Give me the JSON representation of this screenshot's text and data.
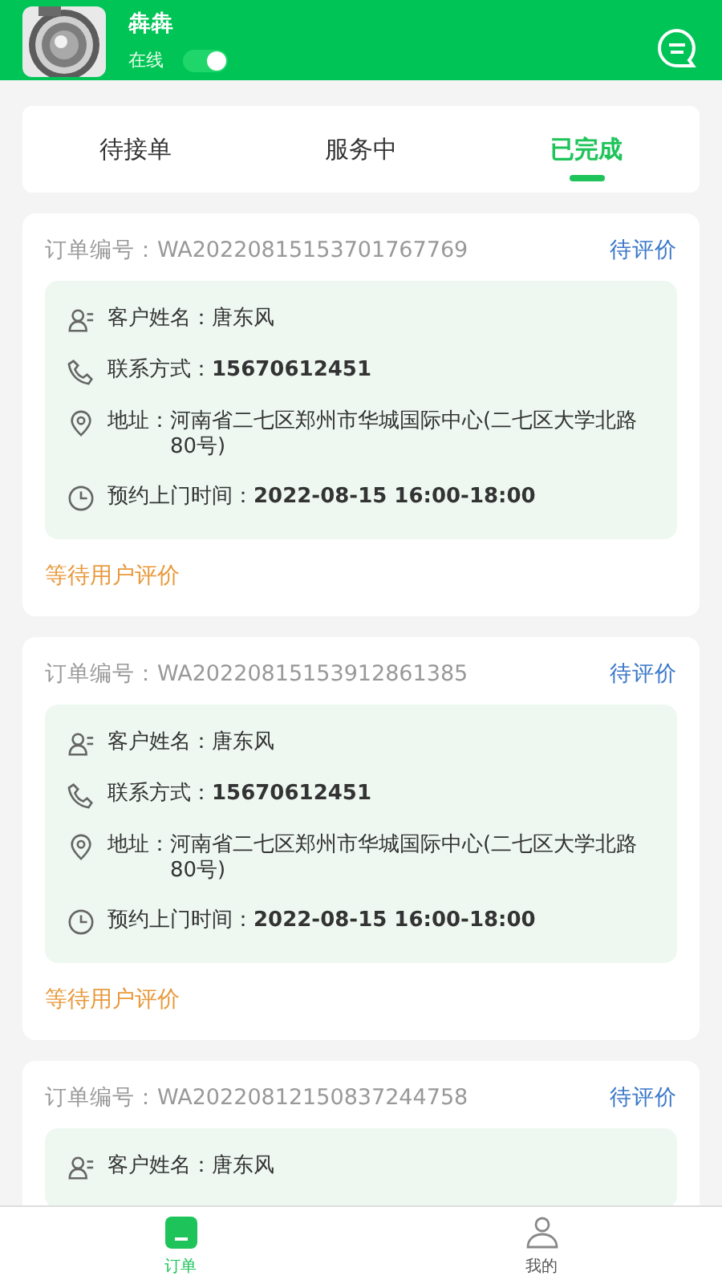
{
  "header": {
    "name": "犇犇",
    "status_label": "在线",
    "online": true
  },
  "tabs": [
    {
      "label": "待接单",
      "selected": false
    },
    {
      "label": "服务中",
      "selected": false
    },
    {
      "label": "已完成",
      "selected": true
    }
  ],
  "orders": [
    {
      "order_no": "订单编号：WA20220815153701767769",
      "status": "待评价",
      "fields": [
        {
          "kind": "person",
          "label": "客户姓名：",
          "value": "唐东风",
          "bold": false
        },
        {
          "kind": "phone",
          "label": "联系方式：",
          "value": "15670612451",
          "bold": true
        },
        {
          "kind": "location",
          "label": "地址：",
          "value": "河南省二七区郑州市华城国际中心(二七区大学北路80号)",
          "bold": false
        },
        {
          "kind": "clock",
          "label": "预约上门时间：",
          "value": "2022-08-15 16:00-18:00",
          "bold": true
        }
      ],
      "footer": "等待用户评价"
    },
    {
      "order_no": "订单编号：WA20220815153912861385",
      "status": "待评价",
      "fields": [
        {
          "kind": "person",
          "label": "客户姓名：",
          "value": "唐东风",
          "bold": false
        },
        {
          "kind": "phone",
          "label": "联系方式：",
          "value": "15670612451",
          "bold": true
        },
        {
          "kind": "location",
          "label": "地址：",
          "value": "河南省二七区郑州市华城国际中心(二七区大学北路80号)",
          "bold": false
        },
        {
          "kind": "clock",
          "label": "预约上门时间：",
          "value": "2022-08-15 16:00-18:00",
          "bold": true
        }
      ],
      "footer": "等待用户评价"
    },
    {
      "order_no": "订单编号：WA20220812150837244758",
      "status": "待评价",
      "fields": [
        {
          "kind": "person",
          "label": "客户姓名：",
          "value": "唐东风",
          "bold": false
        }
      ]
    }
  ],
  "bottom_nav": [
    {
      "kind": "orders",
      "label": "订单",
      "selected": true
    },
    {
      "kind": "profile",
      "label": "我的",
      "selected": false
    }
  ]
}
